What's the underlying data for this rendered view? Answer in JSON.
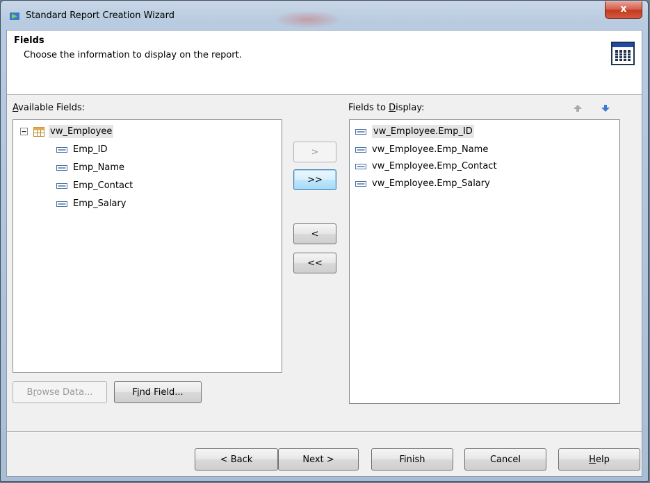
{
  "window": {
    "title": "Standard Report Creation Wizard",
    "close_label": "x"
  },
  "header": {
    "title": "Fields",
    "subtitle": "Choose the information to display on the report."
  },
  "available": {
    "label_key": "A",
    "label_rest": "vailable Fields:",
    "table_name": "vw_Employee",
    "fields": [
      "Emp_ID",
      "Emp_Name",
      "Emp_Contact",
      "Emp_Salary"
    ]
  },
  "display": {
    "label_pre": "Fields to ",
    "label_key": "D",
    "label_rest": "isplay:",
    "fields": [
      "vw_Employee.Emp_ID",
      "vw_Employee.Emp_Name",
      "vw_Employee.Emp_Contact",
      "vw_Employee.Emp_Salary"
    ]
  },
  "move_buttons": {
    "add": ">",
    "add_all": ">>",
    "remove": "<",
    "remove_all": "<<"
  },
  "browse": {
    "pre": "B",
    "key": "r",
    "rest": "owse Data..."
  },
  "find": {
    "pre": "F",
    "key": "i",
    "rest": "nd Field..."
  },
  "nav": {
    "back": "< Back",
    "next": "Next >",
    "finish": "Finish",
    "cancel": "Cancel",
    "help_key": "H",
    "help_rest": "elp"
  }
}
